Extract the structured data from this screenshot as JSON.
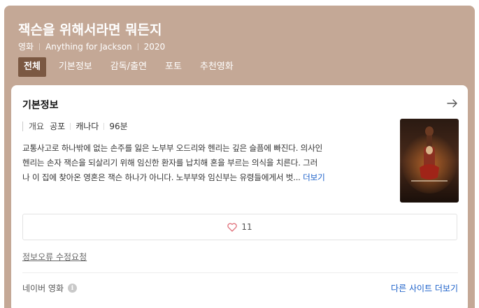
{
  "header": {
    "title": "잭슨을 위해서라면 뭐든지",
    "category": "영화",
    "english_title": "Anything for Jackson",
    "year": "2020"
  },
  "tabs": [
    {
      "label": "전체",
      "active": true
    },
    {
      "label": "기본정보",
      "active": false
    },
    {
      "label": "감독/출연",
      "active": false
    },
    {
      "label": "포토",
      "active": false
    },
    {
      "label": "추천영화",
      "active": false
    }
  ],
  "card": {
    "title": "기본정보",
    "info": {
      "label": "개요",
      "genre": "공포",
      "country": "캐나다",
      "runtime": "96분"
    },
    "description_lines": [
      "교통사고로 하나밖에 없는 손주를 잃은 노부부 오드리와 헨리는 깊은 슬픔에 빠진다. 의사인",
      "헨리는 손자 잭슨을 되살리기 위해 임신한 환자를 납치해 혼을 부르는 의식을 치른다. 그러",
      "나 이 집에 찾아온 영혼은 잭슨 하나가 아니다. 노부부와 임신부는 유령들에게서 벗..."
    ],
    "more_label": "더보기",
    "poster_text": "ANYTHING FOR JACKSON",
    "like_count": "11",
    "report_label": "정보오류 수정요청"
  },
  "footer": {
    "source_label": "네이버 영화",
    "info_glyph": "i",
    "other_sites_label": "다른 사이트 더보기"
  },
  "colors": {
    "header_bg": "#c4a896",
    "active_tab_bg": "#7b5842",
    "link": "#1a5fc9"
  }
}
